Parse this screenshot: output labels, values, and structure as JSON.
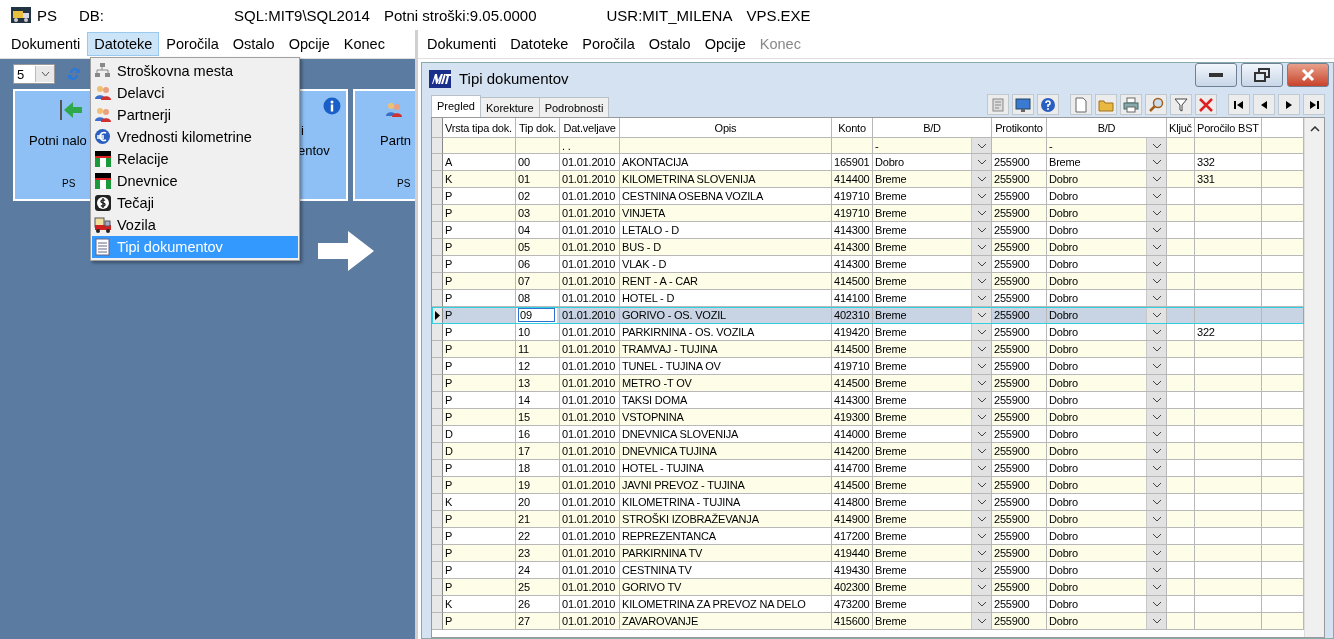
{
  "title_bar": {
    "app": "PS",
    "texts": [
      "DB:",
      "SQL:MIT9\\SQL2014",
      "Potni stroški:9.05.0000",
      "USR:MIT_MILENA",
      "VPS.EXE"
    ]
  },
  "left_menu": [
    {
      "label": "Dokumenti",
      "selected": false
    },
    {
      "label": "Datoteke",
      "selected": true
    },
    {
      "label": "Poročila",
      "selected": false
    },
    {
      "label": "Ostalo",
      "selected": false
    },
    {
      "label": "Opcije",
      "selected": false
    },
    {
      "label": "Konec",
      "selected": false
    }
  ],
  "right_menu": [
    {
      "label": "Dokumenti",
      "disabled": false
    },
    {
      "label": "Datoteke",
      "disabled": false
    },
    {
      "label": "Poročila",
      "disabled": false
    },
    {
      "label": "Ostalo",
      "disabled": false
    },
    {
      "label": "Opcije",
      "disabled": false
    },
    {
      "label": "Konec",
      "disabled": true
    }
  ],
  "left_panel": {
    "page_size": "5",
    "tiles": [
      {
        "kind": "arrow",
        "lines": [
          "Potni nalo"
        ],
        "footer": "PS"
      },
      {
        "kind": "info",
        "lines": [
          "i",
          "entov"
        ]
      },
      {
        "kind": "people",
        "lines": [
          "Partn"
        ],
        "footer": "PS"
      }
    ]
  },
  "dropdown_menu": [
    {
      "label": "Stroškovna mesta",
      "kind": "tree",
      "selected": false
    },
    {
      "label": "Delavci",
      "kind": "people",
      "selected": false
    },
    {
      "label": "Partnerji",
      "kind": "people",
      "selected": false
    },
    {
      "label": "Vrednosti kilometrine",
      "kind": "euro",
      "selected": false
    },
    {
      "label": "Relacije",
      "kind": "flag",
      "selected": false
    },
    {
      "label": "Dnevnice",
      "kind": "flag",
      "selected": false
    },
    {
      "label": "Tečaji",
      "kind": "dollar",
      "selected": false
    },
    {
      "label": "Vozila",
      "kind": "truck",
      "selected": false
    },
    {
      "label": "Tipi dokumentov",
      "kind": "list",
      "selected": true
    }
  ],
  "window": {
    "title": "Tipi dokumentov",
    "tabs": [
      {
        "label": "Pregled",
        "selected": true
      },
      {
        "label": "Korekture",
        "selected": false
      },
      {
        "label": "Podrobnosti",
        "selected": false
      }
    ],
    "columns": [
      "Vrsta tipa dok.",
      "Tip dok.",
      "Dat.veljave",
      "Opis",
      "Konto",
      "B/D",
      "Protikonto",
      "B/D",
      "Ključ",
      "Poročilo BST"
    ],
    "filter": {
      "date": ". .",
      "bd": "-",
      "bd2": "-"
    },
    "rows": [
      {
        "cells": [
          "A",
          "00",
          "01.01.2010",
          "AKONTACIJA",
          "165901",
          "Dobro",
          "255900",
          "Breme",
          "",
          "332"
        ],
        "selected": false
      },
      {
        "cells": [
          "K",
          "01",
          "01.01.2010",
          "KILOMETRINA  SLOVENIJA",
          "414400",
          "Breme",
          "255900",
          "Dobro",
          "",
          "331"
        ],
        "selected": false
      },
      {
        "cells": [
          "P",
          "02",
          "01.01.2010",
          "CESTNINA OSEBNA VOZILA",
          "419710",
          "Breme",
          "255900",
          "Dobro",
          "",
          ""
        ],
        "selected": false
      },
      {
        "cells": [
          "P",
          "03",
          "01.01.2010",
          "VINJETA",
          "419710",
          "Breme",
          "255900",
          "Dobro",
          "",
          ""
        ],
        "selected": false
      },
      {
        "cells": [
          "P",
          "04",
          "01.01.2010",
          "LETALO -  D",
          "414300",
          "Breme",
          "255900",
          "Dobro",
          "",
          ""
        ],
        "selected": false
      },
      {
        "cells": [
          "P",
          "05",
          "01.01.2010",
          "BUS - D",
          "414300",
          "Breme",
          "255900",
          "Dobro",
          "",
          ""
        ],
        "selected": false
      },
      {
        "cells": [
          "P",
          "06",
          "01.01.2010",
          "VLAK - D",
          "414300",
          "Breme",
          "255900",
          "Dobro",
          "",
          ""
        ],
        "selected": false
      },
      {
        "cells": [
          "P",
          "07",
          "01.01.2010",
          "RENT  -  A  - CAR",
          "414500",
          "Breme",
          "255900",
          "Dobro",
          "",
          ""
        ],
        "selected": false
      },
      {
        "cells": [
          "P",
          "08",
          "01.01.2010",
          "HOTEL - D",
          "414100",
          "Breme",
          "255900",
          "Dobro",
          "",
          ""
        ],
        "selected": false
      },
      {
        "cells": [
          "P",
          "09",
          "01.01.2010",
          "GORIVO - OS. VOZIL",
          "402310",
          "Breme",
          "255900",
          "Dobro",
          "",
          ""
        ],
        "selected": true
      },
      {
        "cells": [
          "P",
          "10",
          "01.01.2010",
          "PARKIRNINA - OS. VOZILA",
          "419420",
          "Breme",
          "255900",
          "Dobro",
          "",
          "322"
        ],
        "selected": false
      },
      {
        "cells": [
          "P",
          "11",
          "01.01.2010",
          "TRAMVAJ - TUJINA",
          "414500",
          "Breme",
          "255900",
          "Dobro",
          "",
          ""
        ],
        "selected": false
      },
      {
        "cells": [
          "P",
          "12",
          "01.01.2010",
          "TUNEL - TUJINA OV",
          "419710",
          "Breme",
          "255900",
          "Dobro",
          "",
          ""
        ],
        "selected": false
      },
      {
        "cells": [
          "P",
          "13",
          "01.01.2010",
          "METRO -T OV",
          "414500",
          "Breme",
          "255900",
          "Dobro",
          "",
          ""
        ],
        "selected": false
      },
      {
        "cells": [
          "P",
          "14",
          "01.01.2010",
          "TAKSI DOMA",
          "414300",
          "Breme",
          "255900",
          "Dobro",
          "",
          ""
        ],
        "selected": false
      },
      {
        "cells": [
          "P",
          "15",
          "01.01.2010",
          "VSTOPNINA",
          "419300",
          "Breme",
          "255900",
          "Dobro",
          "",
          ""
        ],
        "selected": false
      },
      {
        "cells": [
          "D",
          "16",
          "01.01.2010",
          "DNEVNICA SLOVENIJA",
          "414000",
          "Breme",
          "255900",
          "Dobro",
          "",
          ""
        ],
        "selected": false
      },
      {
        "cells": [
          "D",
          "17",
          "01.01.2010",
          "DNEVNICA TUJINA",
          "414200",
          "Breme",
          "255900",
          "Dobro",
          "",
          ""
        ],
        "selected": false
      },
      {
        "cells": [
          "P",
          "18",
          "01.01.2010",
          "HOTEL - TUJINA",
          "414700",
          "Breme",
          "255900",
          "Dobro",
          "",
          ""
        ],
        "selected": false
      },
      {
        "cells": [
          "P",
          "19",
          "01.01.2010",
          "JAVNI PREVOZ - TUJINA",
          "414500",
          "Breme",
          "255900",
          "Dobro",
          "",
          ""
        ],
        "selected": false
      },
      {
        "cells": [
          "K",
          "20",
          "01.01.2010",
          "KILOMETRINA - TUJINA",
          "414800",
          "Breme",
          "255900",
          "Dobro",
          "",
          ""
        ],
        "selected": false
      },
      {
        "cells": [
          "P",
          "21",
          "01.01.2010",
          "STROŠKI IZOBRAŽEVANJA",
          "414900",
          "Breme",
          "255900",
          "Dobro",
          "",
          ""
        ],
        "selected": false
      },
      {
        "cells": [
          "P",
          "22",
          "01.01.2010",
          "REPREZENTANCA",
          "417200",
          "Breme",
          "255900",
          "Dobro",
          "",
          ""
        ],
        "selected": false
      },
      {
        "cells": [
          "P",
          "23",
          "01.01.2010",
          "PARKIRNINA TV",
          "419440",
          "Breme",
          "255900",
          "Dobro",
          "",
          ""
        ],
        "selected": false
      },
      {
        "cells": [
          "P",
          "24",
          "01.01.2010",
          "CESTNINA TV",
          "419430",
          "Breme",
          "255900",
          "Dobro",
          "",
          ""
        ],
        "selected": false
      },
      {
        "cells": [
          "P",
          "25",
          "01.01.2010",
          "GORIVO TV",
          "402300",
          "Breme",
          "255900",
          "Dobro",
          "",
          ""
        ],
        "selected": false
      },
      {
        "cells": [
          "K",
          "26",
          "01.01.2010",
          "KILOMETRINA ZA PREVOZ NA DELO",
          "473200",
          "Breme",
          "255900",
          "Dobro",
          "",
          ""
        ],
        "selected": false
      },
      {
        "cells": [
          "P",
          "27",
          "01.01.2010",
          "ZAVAROVANJE",
          "415600",
          "Breme",
          "255900",
          "Dobro",
          "",
          ""
        ],
        "selected": false
      }
    ]
  }
}
